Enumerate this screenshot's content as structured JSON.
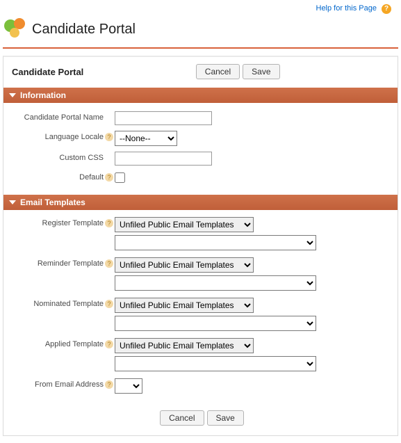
{
  "help_link_text": "Help for this Page",
  "page_title": "Candidate Portal",
  "toolbar": {
    "title": "Candidate Portal",
    "cancel": "Cancel",
    "save": "Save"
  },
  "section_information": "Information",
  "section_email_templates": "Email Templates",
  "info": {
    "name_label": "Candidate Portal Name",
    "name_value": "",
    "locale_label": "Language Locale",
    "locale_value": "--None--",
    "css_label": "Custom CSS",
    "css_value": "",
    "default_label": "Default"
  },
  "templates": {
    "folder_option": "Unfiled Public Email Templates",
    "register_label": "Register Template",
    "reminder_label": "Reminder Template",
    "nominated_label": "Nominated Template",
    "applied_label": "Applied Template",
    "from_label": "From Email Address"
  }
}
